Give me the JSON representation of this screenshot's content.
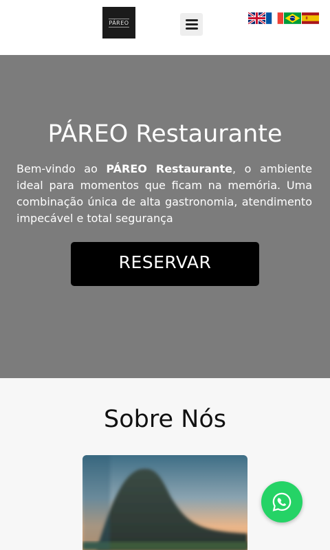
{
  "header": {
    "logo_text": "PÁREO",
    "menu_icon": "hamburger-menu-icon",
    "languages": [
      {
        "code": "en",
        "icon": "uk-flag-icon"
      },
      {
        "code": "fr",
        "icon": "france-flag-icon"
      },
      {
        "code": "pt",
        "icon": "brazil-flag-icon"
      },
      {
        "code": "es",
        "icon": "spain-flag-icon"
      }
    ]
  },
  "hero": {
    "title": "PÁREO Restaurante",
    "text_before": "Bem-vindo ao ",
    "text_bold": "PÁREO Restaurante",
    "text_after": ", o ambiente ideal para momentos que ficam na memória. Uma combinação única de alta gastronomia, atendimento impecável e total segurança",
    "button_label": "RESERVAR",
    "background_color": "#7c7c7c"
  },
  "about": {
    "title": "Sobre Nós",
    "image_icon": "mountain-sunset-photo"
  },
  "whatsapp": {
    "icon": "whatsapp-icon",
    "color": "#25d366"
  }
}
